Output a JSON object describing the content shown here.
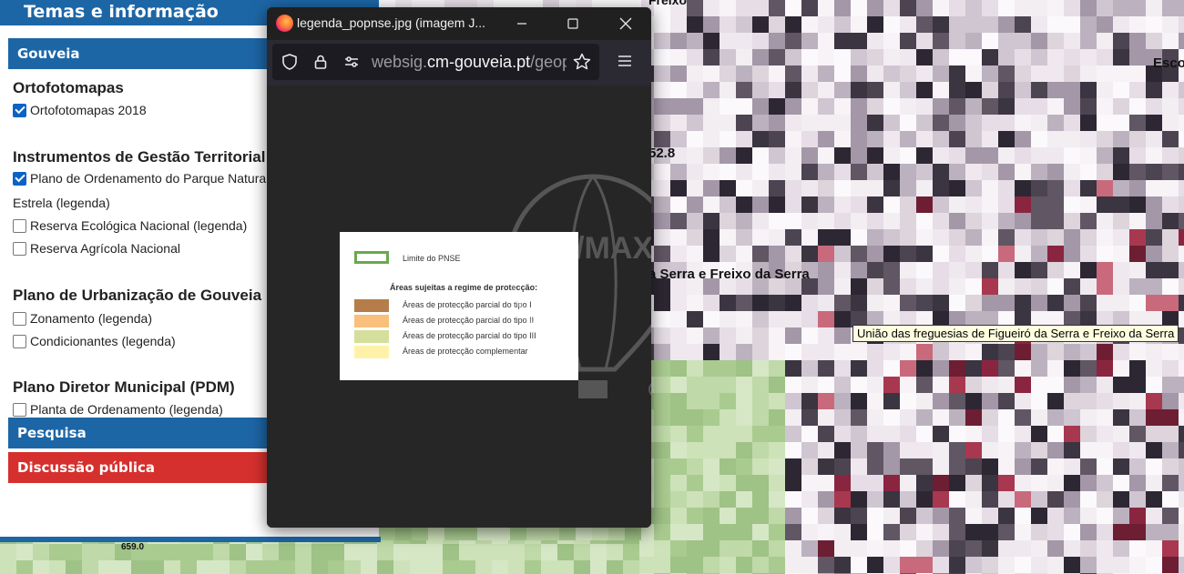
{
  "panel": {
    "header_title": "Temas e informação",
    "accordion_gouveia": "Gouveia",
    "accordion_pesquisa": "Pesquisa",
    "accordion_discussao": "Discussão pública",
    "sections": [
      {
        "title": "Ortofotomapas"
      },
      {
        "title": "Instrumentos de Gestão Territorial"
      },
      {
        "title": "Plano de Urbanização de Gouveia"
      },
      {
        "title": "Plano Diretor Municipal (PDM)"
      }
    ],
    "layers": [
      {
        "label": "Ortofotomapas 2018",
        "checked": true,
        "legend": ""
      },
      {
        "label": "Plano de Ordenamento do Parque Natural da",
        "checked": true,
        "legend": ""
      },
      {
        "label": "Estrela",
        "checked": false,
        "legend": "(legenda)"
      },
      {
        "label": "Reserva Ecológica Nacional",
        "checked": false,
        "legend": "(legenda)"
      },
      {
        "label": "Reserva Agrícola Nacional",
        "checked": false,
        "legend": ""
      },
      {
        "label": "Zonamento",
        "checked": false,
        "legend": "(legenda)"
      },
      {
        "label": "Condicionantes",
        "checked": false,
        "legend": "(legenda)"
      },
      {
        "label": "Planta de Ordenamento",
        "checked": false,
        "legend": "(legenda)"
      }
    ]
  },
  "popup": {
    "window_title": "legenda_popnse.jpg (imagem J...",
    "url_prefix": "websig.",
    "url_domain": "cm-gouveia.pt",
    "url_path": "/geopo",
    "legend": {
      "boundary_label": "Limite do PNSE",
      "regime_title": "Áreas sujeitas a regime de protecção:",
      "items": [
        {
          "label": "Áreas de protecção parcial do tipo I",
          "color": "#b67c4a"
        },
        {
          "label": "Áreas de protecção parcial do tipo II",
          "color": "#f8c07a"
        },
        {
          "label": "Áreas de protecção parcial do tipo III",
          "color": "#d3df9b"
        },
        {
          "label": "Áreas de protecção complementar",
          "color": "#fff2a8"
        }
      ],
      "boundary_color": "#6aa84f"
    },
    "watermark_text": "RE/MAX"
  },
  "map": {
    "label_top": "Freixo",
    "label_right": "Esco",
    "label_elevation": "52.8",
    "label_serra": "a Serra e Freixo da Serra",
    "label_elevation_bottom": "659.0",
    "tooltip": "União das freguesias de Figueiró da Serra e Freixo da Serra"
  },
  "colors": {
    "panel_blue": "#1d66a6",
    "discussion_red": "#d6302e",
    "checkbox_blue": "#0b63c4"
  }
}
